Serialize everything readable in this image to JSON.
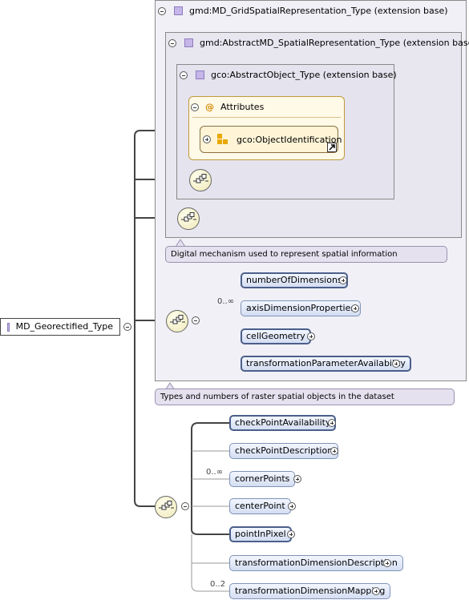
{
  "root": {
    "label": "MD_Georectified_Type"
  },
  "base1": {
    "label": "gmd:MD_GridSpatialRepresentation_Type (extension base)"
  },
  "base2": {
    "label": "gmd:AbstractMD_SpatialRepresentation_Type (extension base)"
  },
  "base3": {
    "label": "gco:AbstractObject_Type (extension base)"
  },
  "attributes": {
    "label": "Attributes",
    "icon": "@",
    "item": "gco:ObjectIdentification"
  },
  "annotations": {
    "spatial": "Digital mechanism used to represent spatial information",
    "grid": "Types and numbers of raster spatial objects in the dataset"
  },
  "grid_elements": [
    {
      "label": "numberOfDimensions",
      "card": ""
    },
    {
      "label": "axisDimensionProperties",
      "card": "0..∞"
    },
    {
      "label": "cellGeometry",
      "card": ""
    },
    {
      "label": "transformationParameterAvailability",
      "card": ""
    }
  ],
  "georect_elements": [
    {
      "label": "checkPointAvailability",
      "card": ""
    },
    {
      "label": "checkPointDescription",
      "card": ""
    },
    {
      "label": "cornerPoints",
      "card": "0..∞"
    },
    {
      "label": "centerPoint",
      "card": ""
    },
    {
      "label": "pointInPixel",
      "card": ""
    },
    {
      "label": "transformationDimensionDescription",
      "card": ""
    },
    {
      "label": "transformationDimensionMapping",
      "card": "0..2"
    }
  ]
}
